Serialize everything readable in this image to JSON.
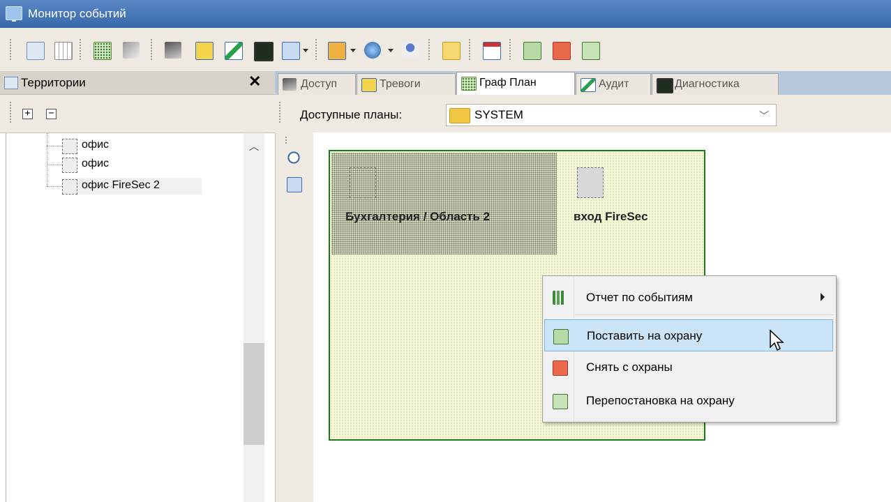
{
  "window": {
    "title": "Монитор событий"
  },
  "left_panel": {
    "title": "Территории",
    "expand_label": "+",
    "collapse_label": "−",
    "tree": [
      {
        "label": "офис"
      },
      {
        "label": "офис"
      },
      {
        "label": "офис FireSec 2"
      }
    ]
  },
  "tabs": [
    {
      "label": "Доступ",
      "icon": "flashlight-icon"
    },
    {
      "label": "Тревоги",
      "icon": "alarm-warning-icon"
    },
    {
      "label": "Граф План",
      "icon": "graph-plan-icon",
      "active": true
    },
    {
      "label": "Аудит",
      "icon": "audit-pencil-icon"
    },
    {
      "label": "Диагностика",
      "icon": "diagnostics-monitor-icon"
    }
  ],
  "plans": {
    "label": "Доступные планы:",
    "selected": "SYSTEM"
  },
  "plan": {
    "zone_label": "Бухгалтерия / Область 2",
    "door_label": "вход FireSec"
  },
  "context_menu": {
    "items": [
      {
        "label": "Отчет по событиям",
        "icon": "chart-icon",
        "submenu": true
      },
      {
        "label": "Поставить на охрану",
        "icon": "arm-icon",
        "highlighted": true
      },
      {
        "label": "Снять с охраны",
        "icon": "disarm-icon"
      },
      {
        "label": "Перепостановка на охрану",
        "icon": "rearm-icon"
      }
    ]
  },
  "colors": {
    "titlebar": "#3d6fb0",
    "tabs_bar": "#b5c8dc",
    "plan_border": "#1a7a1a",
    "menu_highlight": "#cce4f7"
  }
}
